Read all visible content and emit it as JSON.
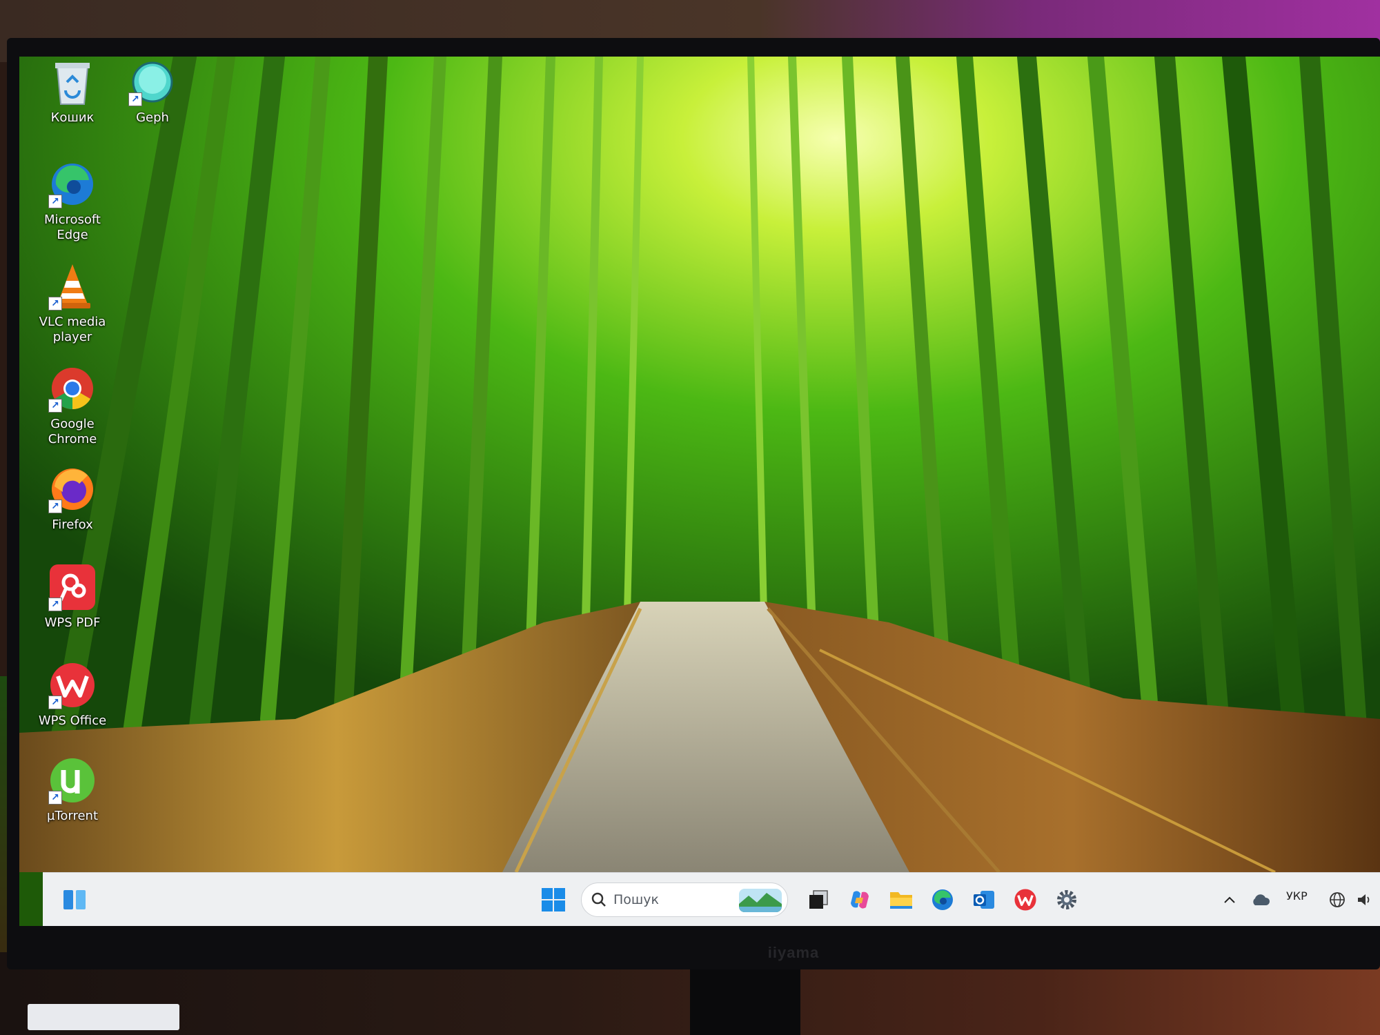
{
  "monitor": {
    "brand": "iiyama"
  },
  "desktop_icons": [
    {
      "id": "recycle-bin",
      "label": "Кошик",
      "icon": "recycle-bin-icon",
      "shortcut": false
    },
    {
      "id": "geph",
      "label": "Geph",
      "icon": "geph-icon",
      "shortcut": true
    },
    {
      "id": "edge",
      "label": "Microsoft Edge",
      "icon": "edge-icon",
      "shortcut": true
    },
    {
      "id": "vlc",
      "label": "VLC media player",
      "icon": "vlc-icon",
      "shortcut": true
    },
    {
      "id": "chrome",
      "label": "Google Chrome",
      "icon": "chrome-icon",
      "shortcut": true
    },
    {
      "id": "firefox",
      "label": "Firefox",
      "icon": "firefox-icon",
      "shortcut": true
    },
    {
      "id": "wps-pdf",
      "label": "WPS PDF",
      "icon": "wps-pdf-icon",
      "shortcut": true
    },
    {
      "id": "wps-office",
      "label": "WPS Office",
      "icon": "wps-office-icon",
      "shortcut": true
    },
    {
      "id": "utorrent",
      "label": "µTorrent",
      "icon": "utorrent-icon",
      "shortcut": true
    }
  ],
  "taskbar": {
    "widgets_icon": "widgets-icon",
    "start_icon": "windows-start-icon",
    "search": {
      "placeholder": "Пошук",
      "icon": "search-icon"
    },
    "pinned": [
      {
        "id": "task-view",
        "icon": "task-view-icon"
      },
      {
        "id": "copilot",
        "icon": "copilot-icon"
      },
      {
        "id": "file-explorer",
        "icon": "folder-icon"
      },
      {
        "id": "edge",
        "icon": "edge-icon"
      },
      {
        "id": "outlook",
        "icon": "outlook-icon"
      },
      {
        "id": "wps-office",
        "icon": "wps-office-icon"
      },
      {
        "id": "settings",
        "icon": "settings-gear-icon"
      }
    ],
    "tray": {
      "chevron_icon": "chevron-up-icon",
      "cloud_icon": "onedrive-cloud-icon",
      "language": "УКР",
      "network_icon": "globe-network-icon",
      "volume_icon": "volume-icon"
    }
  },
  "colors": {
    "taskbar_bg": "#eef0f2",
    "windows_blue": "#1a8ce8",
    "wallpaper_green": "#3aa010"
  }
}
